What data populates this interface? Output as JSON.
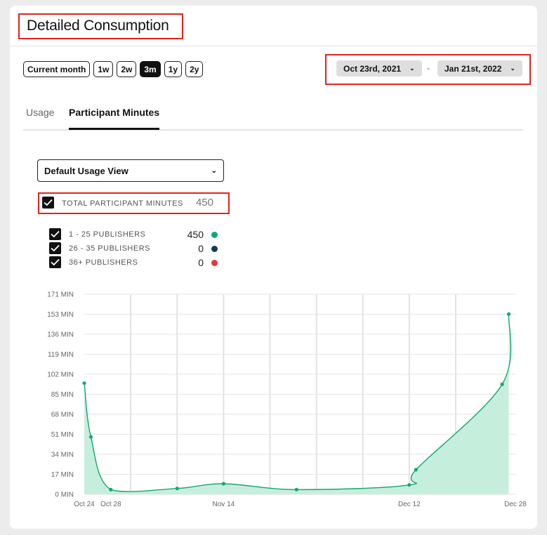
{
  "header": {
    "title": "Detailed Consumption"
  },
  "range_pills": [
    {
      "label": "Current month",
      "active": false
    },
    {
      "label": "1w",
      "active": false
    },
    {
      "label": "2w",
      "active": false
    },
    {
      "label": "3m",
      "active": true
    },
    {
      "label": "1y",
      "active": false
    },
    {
      "label": "2y",
      "active": false
    }
  ],
  "date_range": {
    "start": "Oct 23rd, 2021",
    "separator": "-",
    "end": "Jan 21st, 2022",
    "chevron": "chevron-down-icon"
  },
  "tabs": [
    {
      "label": "Usage",
      "active": false
    },
    {
      "label": "Participant Minutes",
      "active": true
    }
  ],
  "view_select": {
    "value": "Default Usage View"
  },
  "total": {
    "label": "TOTAL PARTICIPANT MINUTES",
    "value": "450",
    "checked": true
  },
  "series_filters": [
    {
      "label": "1 - 25 PUBLISHERS",
      "value": "450",
      "color": "#12a86f",
      "checked": true
    },
    {
      "label": "26 - 35 PUBLISHERS",
      "value": "0",
      "color": "#0e3d55",
      "checked": true
    },
    {
      "label": "36+ PUBLISHERS",
      "value": "0",
      "color": "#e53935",
      "checked": true
    }
  ],
  "chart_data": {
    "type": "area",
    "ylim": [
      0,
      171
    ],
    "y_ticks": [
      "171 MIN",
      "153 MIN",
      "136 MIN",
      "119 MIN",
      "102 MIN",
      "85 MIN",
      "68 MIN",
      "51 MIN",
      "34 MIN",
      "17 MIN",
      "0 MIN"
    ],
    "x_tick_labels": [
      {
        "label": "Oct 24",
        "date": "2021-10-24"
      },
      {
        "label": "Oct 28",
        "date": "2021-10-28"
      },
      {
        "label": "Nov 14",
        "date": "2021-11-14"
      },
      {
        "label": "Dec 12",
        "date": "2021-12-12"
      },
      {
        "label": "Dec 28",
        "date": "2021-12-28"
      }
    ],
    "gridline_dates": [
      "2021-10-31",
      "2021-11-07",
      "2021-11-14",
      "2021-11-21",
      "2021-11-28",
      "2021-12-05",
      "2021-12-12",
      "2021-12-19"
    ],
    "series": [
      {
        "color": "#12a86f",
        "fill": "#c6eedd",
        "points": [
          {
            "x": "2021-10-24",
            "y": 95
          },
          {
            "x": "2021-10-25",
            "y": 49
          },
          {
            "x": "2021-10-28",
            "y": 4
          },
          {
            "x": "2021-11-07",
            "y": 5
          },
          {
            "x": "2021-11-14",
            "y": 9
          },
          {
            "x": "2021-11-25",
            "y": 4
          },
          {
            "x": "2021-12-12",
            "y": 8
          },
          {
            "x": "2021-12-13",
            "y": 21
          },
          {
            "x": "2021-12-26",
            "y": 94
          },
          {
            "x": "2021-12-27",
            "y": 154
          }
        ]
      }
    ]
  }
}
